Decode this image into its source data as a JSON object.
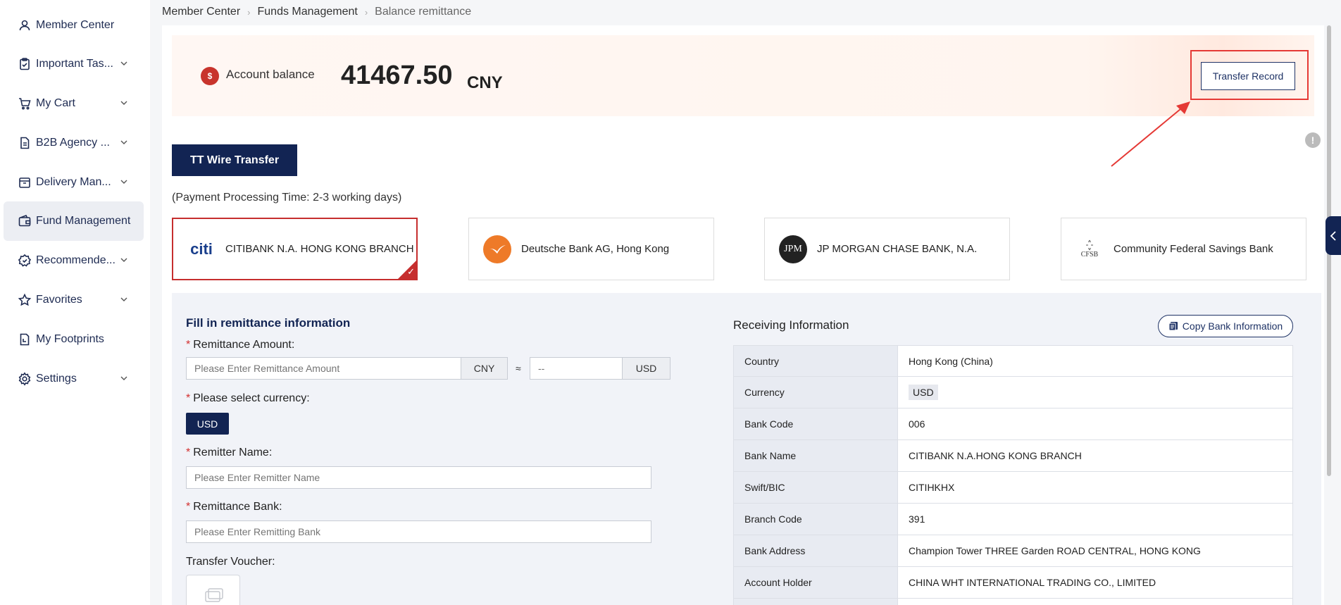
{
  "sidebar": {
    "items": [
      {
        "label": "Member Center",
        "icon": "user-icon",
        "has_chevron": false
      },
      {
        "label": "Important Tas...",
        "icon": "clipboard-icon",
        "has_chevron": true
      },
      {
        "label": "My Cart",
        "icon": "cart-icon",
        "has_chevron": true
      },
      {
        "label": "B2B Agency ...",
        "icon": "document-icon",
        "has_chevron": true
      },
      {
        "label": "Delivery Man...",
        "icon": "box-icon",
        "has_chevron": true
      },
      {
        "label": "Fund Management",
        "icon": "wallet-icon",
        "has_chevron": false,
        "active": true
      },
      {
        "label": "Recommende...",
        "icon": "badge-icon",
        "has_chevron": true
      },
      {
        "label": "Favorites",
        "icon": "star-icon",
        "has_chevron": true
      },
      {
        "label": "My Footprints",
        "icon": "footprint-icon",
        "has_chevron": false
      },
      {
        "label": "Settings",
        "icon": "gear-icon",
        "has_chevron": true
      }
    ]
  },
  "breadcrumb": [
    "Member Center",
    "Funds Management",
    "Balance remittance"
  ],
  "balance": {
    "label": "Account balance",
    "amount": "41467.50",
    "unit": "CNY",
    "record_button": "Transfer Record"
  },
  "tab": {
    "label": "TT Wire Transfer"
  },
  "processing_time": "(Payment Processing Time: 2-3 working days)",
  "banks": [
    {
      "name": "CITIBANK N.A. HONG KONG BRANCH",
      "logo_text": "citi",
      "selected": true
    },
    {
      "name": "Deutsche Bank AG, Hong Kong",
      "logo_text": "",
      "selected": false
    },
    {
      "name": "JP MORGAN CHASE BANK, N.A.",
      "logo_text": "JPM",
      "selected": false
    },
    {
      "name": "Community Federal Savings Bank",
      "logo_text": "CFSB",
      "selected": false
    }
  ],
  "form": {
    "title": "Fill in remittance information",
    "amount_label": "Remittance Amount:",
    "amount_placeholder": "Please Enter Remittance Amount",
    "amount_unit": "CNY",
    "approx": "≈",
    "converted_placeholder": "--",
    "converted_unit": "USD",
    "currency_label": "Please select currency:",
    "currency_value": "USD",
    "remitter_label": "Remitter Name:",
    "remitter_placeholder": "Please Enter Remitter Name",
    "bank_label": "Remittance Bank:",
    "bank_placeholder": "Please Enter Remitting Bank",
    "voucher_label": "Transfer Voucher:"
  },
  "receiving": {
    "title": "Receiving Information",
    "copy_button": "Copy Bank Information",
    "rows": [
      {
        "key": "Country",
        "value": "Hong Kong (China)"
      },
      {
        "key": "Currency",
        "value": "USD"
      },
      {
        "key": "Bank Code",
        "value": "006"
      },
      {
        "key": "Bank Name",
        "value": "CITIBANK N.A.HONG KONG BRANCH"
      },
      {
        "key": "Swift/BIC",
        "value": "CITIHKHX"
      },
      {
        "key": "Branch Code",
        "value": "391"
      },
      {
        "key": "Bank Address",
        "value": "Champion Tower THREE Garden ROAD CENTRAL, HONG KONG"
      },
      {
        "key": "Account Holder",
        "value": "CHINA WHT INTERNATIONAL TRADING CO., LIMITED"
      }
    ]
  },
  "colors": {
    "accent": "#122453",
    "highlight": "#e53935",
    "brand_red": "#c62e2e"
  }
}
